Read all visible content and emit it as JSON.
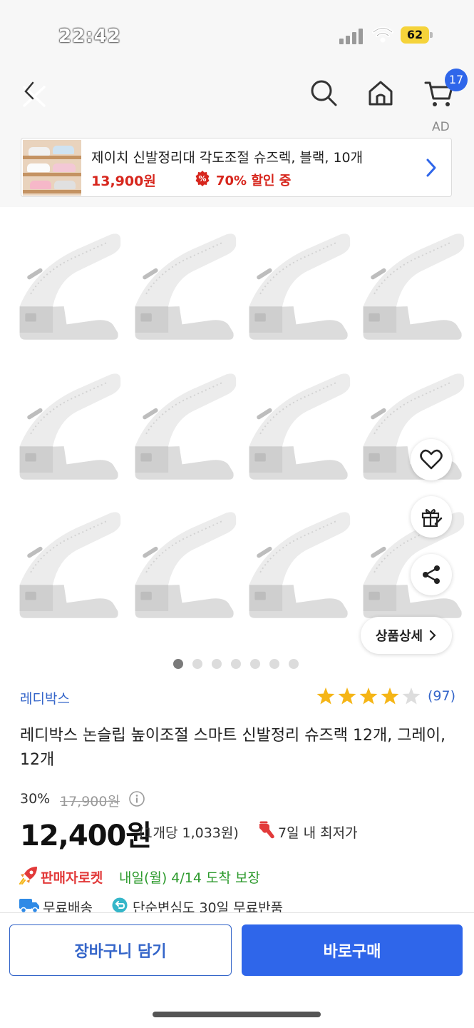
{
  "status_bar": {
    "time": "22:42",
    "battery": "62"
  },
  "nav": {
    "cart_badge": "17",
    "icons": [
      "close-icon",
      "search-icon",
      "home-icon",
      "cart-icon"
    ]
  },
  "ad": {
    "label": "AD",
    "title": "제이치 신발정리대 각도조절 슈즈렉, 블랙, 10개",
    "price": "13,900원",
    "discount": "70% 할인 중"
  },
  "gallery": {
    "total_images": 7,
    "current_index": 1,
    "detail_button": "상품상세",
    "float_icons": [
      "heart-icon",
      "gift-icon",
      "share-icon"
    ]
  },
  "product": {
    "brand": "레디박스",
    "rating": 4,
    "review_count": "(97)",
    "title": "레디박스 논슬립 높이조절 스마트 신발정리 슈즈랙 12개, 그레이, 12개",
    "discount_rate": "30%",
    "original_price": "17,900원",
    "sale_price": "12,400원",
    "unit_price": "(1개당 1,033원)",
    "lowest_badge": "7일 내 최저가"
  },
  "shipping": {
    "rocket_label": "판매자로켓",
    "delivery_date": "내일(월) 4/14 도착 보장",
    "free_shipping": "무료배송",
    "free_return": "단순변심도 30일 무료반품"
  },
  "actions": {
    "add_to_cart": "장바구니 담기",
    "buy_now": "바로구매"
  },
  "colors": {
    "accent_blue": "#2f66ea",
    "price_red": "#d7261d",
    "rocket_red": "#e23a3a",
    "delivery_green": "#2c9a2c",
    "star_yellow": "#f5b516"
  }
}
